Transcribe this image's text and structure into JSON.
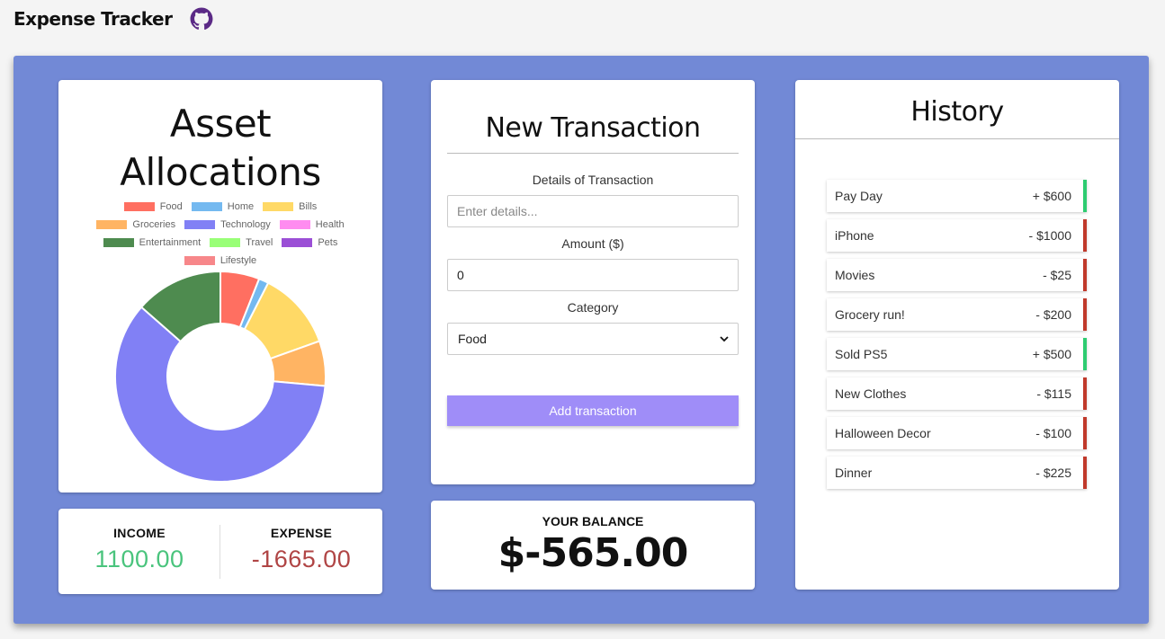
{
  "app": {
    "title": "Expense Tracker",
    "github_icon": "github-icon"
  },
  "allocation": {
    "title_line1": "Asset",
    "title_line2": "Allocations",
    "legend": [
      {
        "label": "Food",
        "color": "#ff6f61"
      },
      {
        "label": "Home",
        "color": "#74b9f0"
      },
      {
        "label": "Bills",
        "color": "#ffd966"
      },
      {
        "label": "Groceries",
        "color": "#ffb463"
      },
      {
        "label": "Technology",
        "color": "#8180f5"
      },
      {
        "label": "Health",
        "color": "#ff8cf0"
      },
      {
        "label": "Entertainment",
        "color": "#4e8b4f"
      },
      {
        "label": "Travel",
        "color": "#99ff77"
      },
      {
        "label": "Pets",
        "color": "#9b4fd6"
      },
      {
        "label": "Lifestyle",
        "color": "#f7878a"
      }
    ]
  },
  "chart_data": {
    "type": "pie",
    "categories": [
      "Food",
      "Home",
      "Bills",
      "Groceries",
      "Technology",
      "Health",
      "Entertainment",
      "Travel",
      "Pets",
      "Lifestyle"
    ],
    "values": [
      100,
      25,
      200,
      115,
      1000,
      0,
      225,
      0,
      0,
      0
    ],
    "colors": [
      "#ff6f61",
      "#74b9f0",
      "#ffd966",
      "#ffb463",
      "#8180f5",
      "#ff8cf0",
      "#4e8b4f",
      "#99ff77",
      "#9b4fd6",
      "#f7878a"
    ],
    "donut": true,
    "legend": "top"
  },
  "summary": {
    "income_label": "INCOME",
    "income_value": "1100.00",
    "expense_label": "EXPENSE",
    "expense_value": "-1665.00"
  },
  "new_transaction": {
    "title": "New Transaction",
    "details_label": "Details of Transaction",
    "details_placeholder": "Enter details...",
    "amount_label": "Amount ($)",
    "amount_value": "0",
    "category_label": "Category",
    "category_selected": "Food",
    "add_button": "Add transaction"
  },
  "balance": {
    "label": "YOUR BALANCE",
    "value": "$-565.00"
  },
  "history": {
    "title": "History",
    "items": [
      {
        "name": "Pay Day",
        "amount": "+ $600",
        "type": "plus"
      },
      {
        "name": "iPhone",
        "amount": "- $1000",
        "type": "minus"
      },
      {
        "name": "Movies",
        "amount": "- $25",
        "type": "minus"
      },
      {
        "name": "Grocery run!",
        "amount": "- $200",
        "type": "minus"
      },
      {
        "name": "Sold PS5",
        "amount": "+ $500",
        "type": "plus"
      },
      {
        "name": "New Clothes",
        "amount": "- $115",
        "type": "minus"
      },
      {
        "name": "Halloween Decor",
        "amount": "- $100",
        "type": "minus"
      },
      {
        "name": "Dinner",
        "amount": "- $225",
        "type": "minus"
      }
    ]
  }
}
